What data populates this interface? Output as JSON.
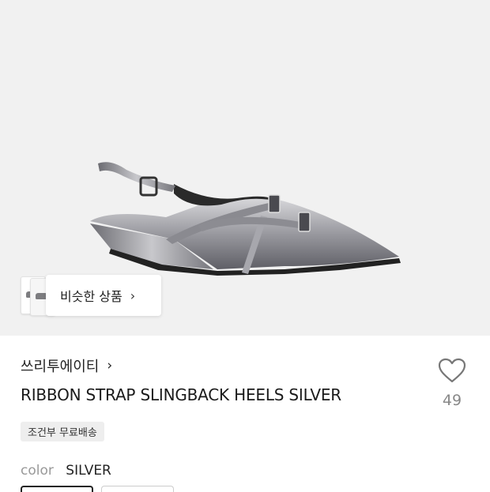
{
  "similar_button": {
    "label": "비슷한 상품",
    "chevron": "chevron-right-icon"
  },
  "shop": {
    "name": "쓰리투에이티",
    "chevron": "chevron-right-icon"
  },
  "product": {
    "title": "RIBBON STRAP SLINGBACK HEELS SILVER",
    "shipping_badge": "조건부 무료배송",
    "color_label": "color",
    "color_value": "SILVER"
  },
  "like": {
    "icon": "heart-icon",
    "count": "49"
  },
  "colors": {
    "hero_bg": "#f1f1f1",
    "badge_bg": "#eeeeee"
  }
}
